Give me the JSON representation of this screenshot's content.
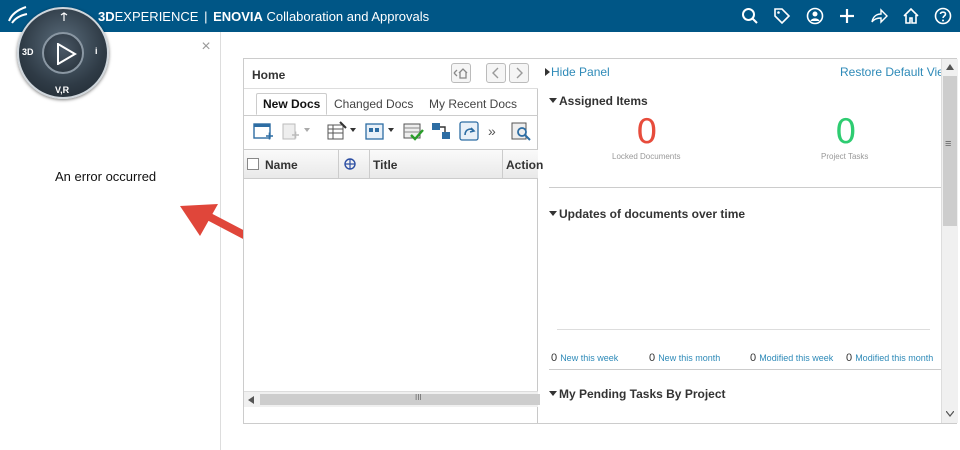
{
  "topbar": {
    "brand_bold": "3D",
    "brand_rest": "EXPERIENCE",
    "separator": "|",
    "app": "ENOVIA",
    "app_title": "Collaboration and Approvals",
    "icons": [
      "search-icon",
      "tag-icon",
      "user-icon",
      "add-icon",
      "share-icon",
      "home-icon",
      "help-icon"
    ]
  },
  "compass": {
    "left": "3D",
    "right": "i",
    "bottom": "V,R"
  },
  "left_panel": {
    "close": "×",
    "error": "An error occurred"
  },
  "widget": {
    "home_title": "Home",
    "tabs": [
      "New Docs",
      "Changed Docs",
      "My Recent Docs"
    ],
    "toolbar_more": "»",
    "columns": [
      "Name",
      "Title",
      "Action"
    ],
    "hscroll_grip": "III"
  },
  "right": {
    "hide_panel": "Hide Panel",
    "restore": "Restore Default View",
    "assigned_title": "Assigned Items",
    "locked_count": "0",
    "locked_label": "Locked Documents",
    "tasks_count": "0",
    "tasks_label": "Project Tasks",
    "updates_title": "Updates of documents over time",
    "stats": [
      {
        "n": "0",
        "label": "New this week"
      },
      {
        "n": "0",
        "label": "New this month"
      },
      {
        "n": "0",
        "label": "Modified this week"
      },
      {
        "n": "0",
        "label": "Modified this month"
      }
    ],
    "pending_title": "My Pending Tasks By Project",
    "vscroll_grip": "≡",
    "colors": {
      "red": "#e74c3c",
      "green": "#2ecc71",
      "link": "#2e8ab8",
      "topbar": "#005686"
    }
  }
}
